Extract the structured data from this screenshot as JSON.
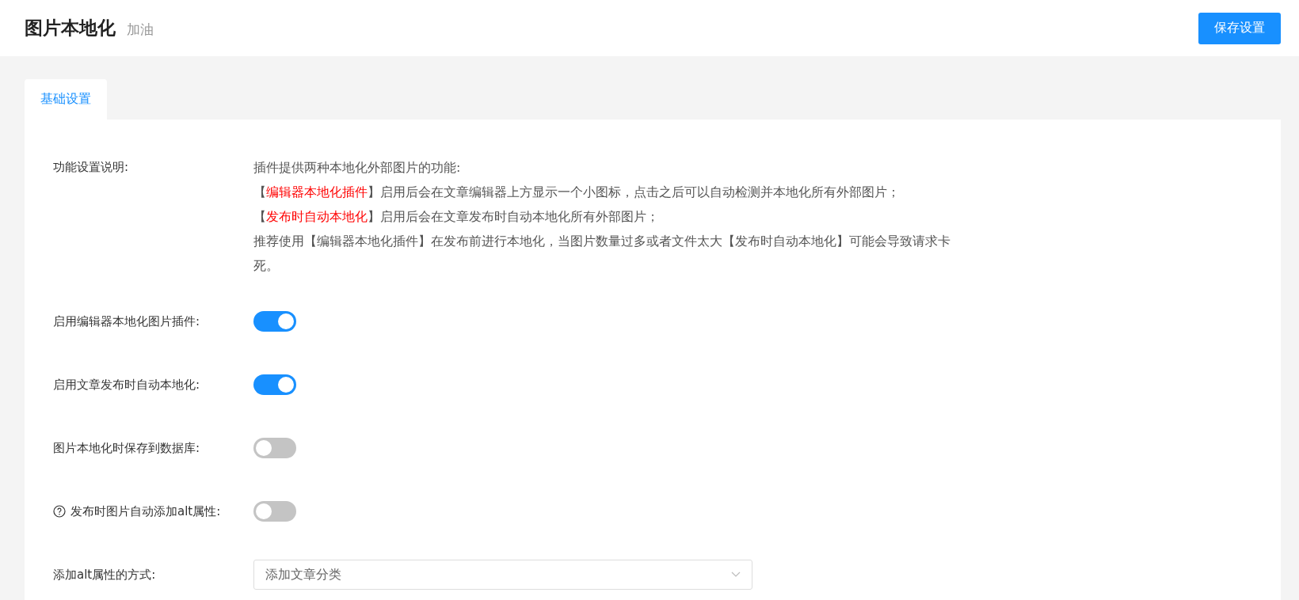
{
  "header": {
    "title": "图片本地化",
    "subtitle": "加油",
    "save_button": "保存设置"
  },
  "tabs": [
    {
      "label": "基础设置",
      "selected": true
    }
  ],
  "description": {
    "label": "功能设置说明:",
    "lines": [
      {
        "text": "插件提供两种本地化外部图片的功能:"
      },
      {
        "prefix": "【",
        "highlight": "编辑器本地化插件",
        "suffix": "】启用后会在文章编辑器上方显示一个小图标，点击之后可以自动检测并本地化所有外部图片；"
      },
      {
        "prefix": "【",
        "highlight": "发布时自动本地化",
        "suffix": "】启用后会在文章发布时自动本地化所有外部图片；"
      },
      {
        "text": "推荐使用【编辑器本地化插件】在发布前进行本地化，当图片数量过多或者文件太大【发布时自动本地化】可能会导致请求卡死。"
      }
    ]
  },
  "settings": [
    {
      "kind": "toggle",
      "label": "启用编辑器本地化图片插件:",
      "on": true
    },
    {
      "kind": "toggle",
      "label": "启用文章发布时自动本地化:",
      "on": true
    },
    {
      "kind": "toggle",
      "label": "图片本地化时保存到数据库:",
      "on": false
    },
    {
      "kind": "toggle",
      "label": "发布时图片自动添加alt属性:",
      "help": true,
      "on": false
    },
    {
      "kind": "select",
      "label": "添加alt属性的方式:",
      "value": "添加文章分类"
    }
  ]
}
